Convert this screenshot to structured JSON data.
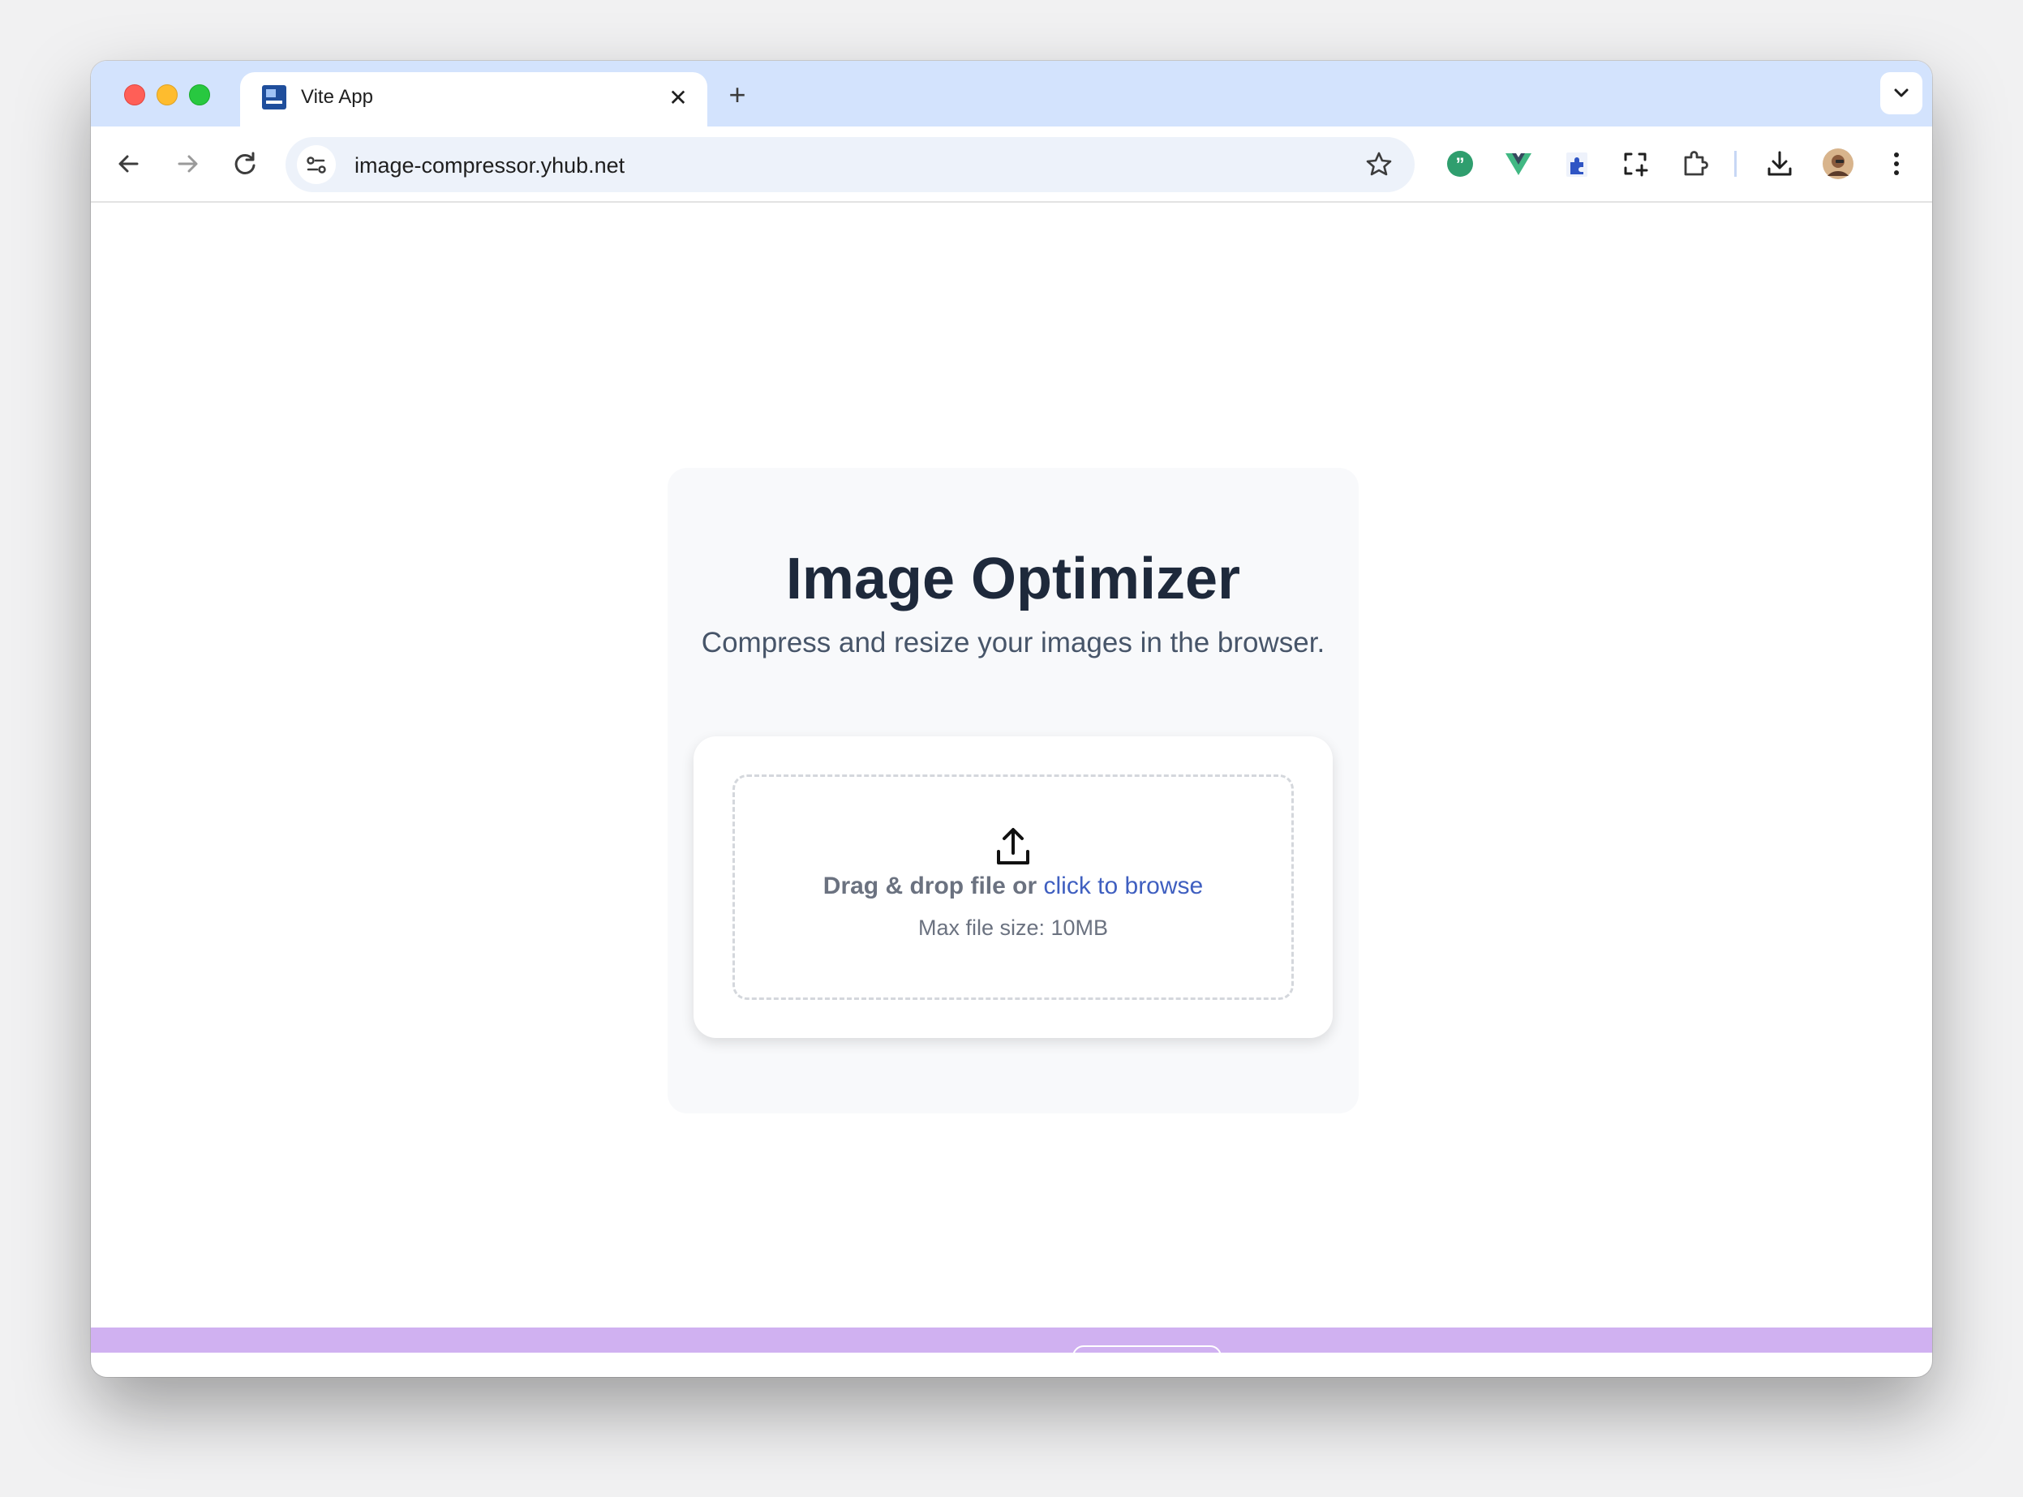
{
  "browser": {
    "tab": {
      "title": "Vite App",
      "close_glyph": "✕"
    },
    "new_tab_glyph": "+",
    "url": "image-compressor.yhub.net",
    "icons": [
      "back-icon",
      "forward-icon",
      "reload-icon",
      "site-info-icon",
      "star-icon",
      "grammar-extension-icon",
      "vue-devtools-icon",
      "puzzle-extension-icon",
      "screenshot-extension-icon",
      "extensions-icon",
      "download-icon",
      "profile-avatar",
      "more-menu-icon",
      "tab-search-icon"
    ],
    "colors": {
      "tabbar": "#d3e3fd",
      "omnibox": "#edf2fa"
    }
  },
  "page": {
    "title": "Image Optimizer",
    "subtitle": "Compress and resize your images in the browser.",
    "dropzone": {
      "text_prefix": "Drag & drop file or",
      "browse_link": "click to browse",
      "max_size": "Max file size: 10MB"
    },
    "colors": {
      "title": "#1e293b",
      "link": "#3f5fc0",
      "bottom_bar": "#d0b1f1"
    }
  }
}
